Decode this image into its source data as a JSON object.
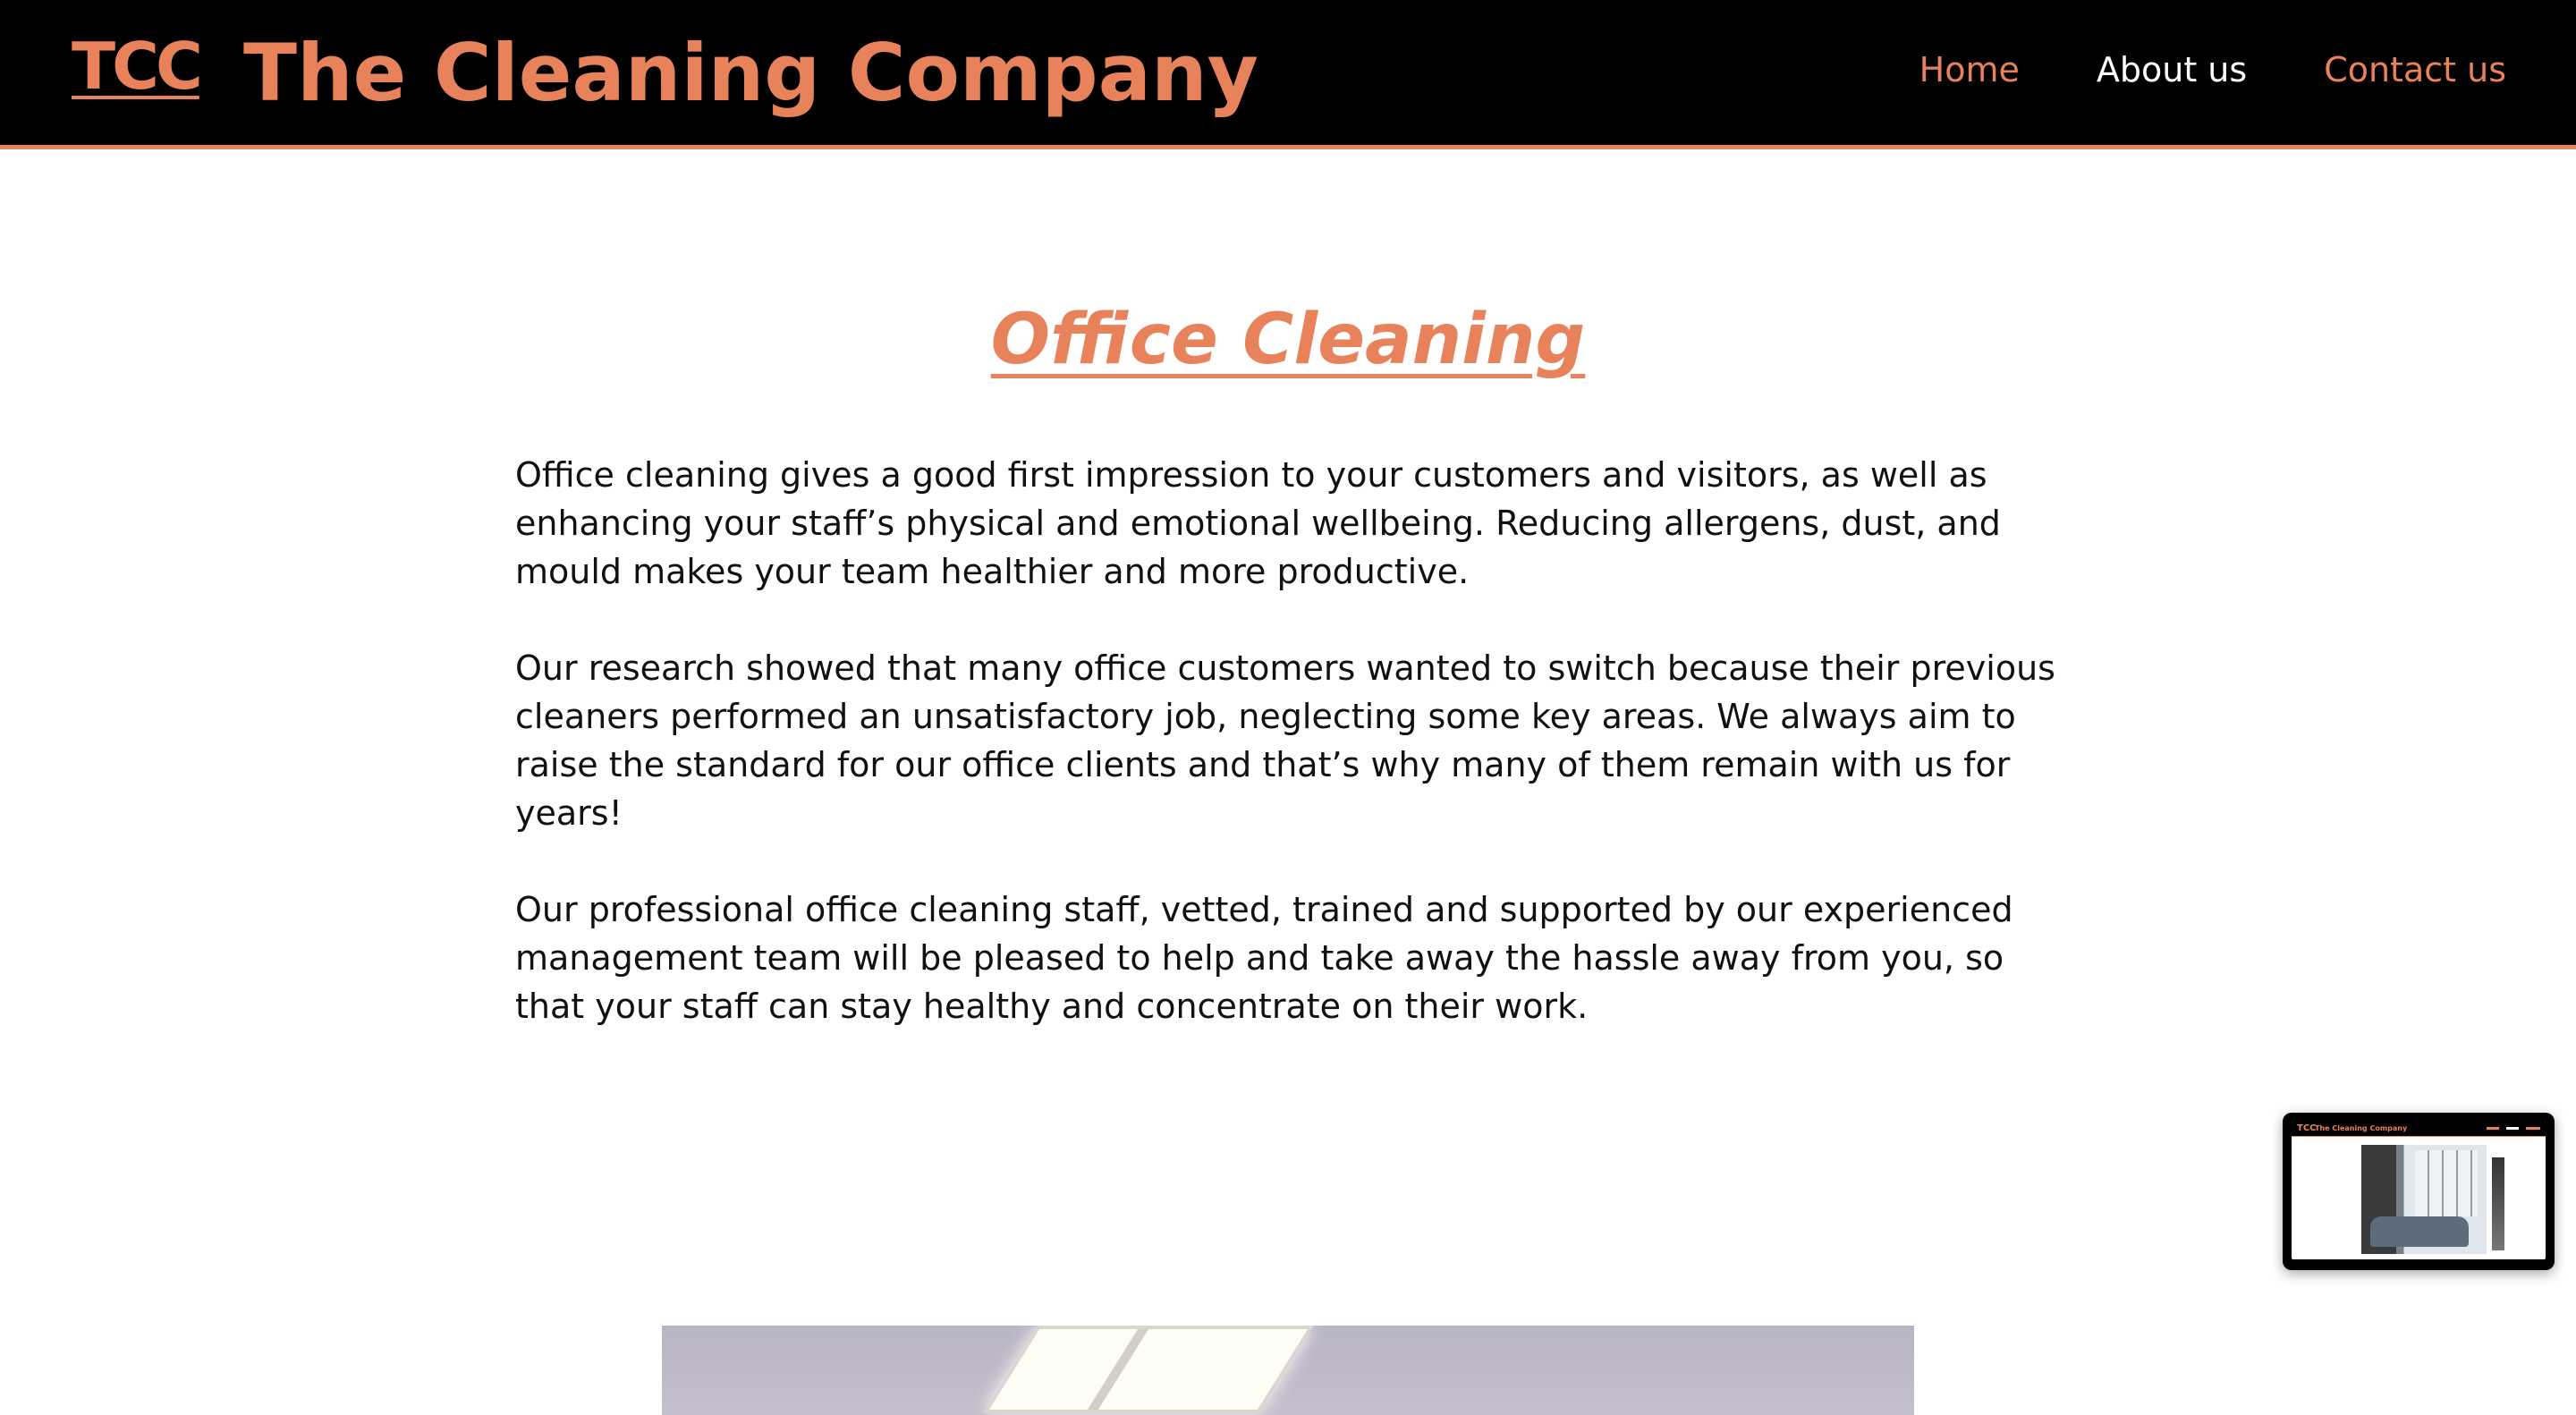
{
  "header": {
    "logo_text": "TCC",
    "site_title": "The Cleaning Company",
    "nav": [
      {
        "label": "Home",
        "active": false
      },
      {
        "label": "About us",
        "active": true
      },
      {
        "label": "Contact us",
        "active": false
      }
    ]
  },
  "main": {
    "title": "Office Cleaning",
    "paragraphs": [
      "Office cleaning gives a good first impression to your customers and visitors, as well as enhancing your staff’s physical and emotional wellbeing. Reducing allergens, dust, and mould makes your team healthier and more productive.",
      "Our research showed that many office customers wanted to switch because their previous cleaners performed an unsatisfactory job, neglecting some key areas. We always aim to raise the standard for our office clients and that’s why many of them remain with us for years!",
      "Our professional office cleaning staff, vetted, trained and supported by our experienced management team will be pleased to help and take away the hassle away from you, so that your staff can stay healthy and concentrate on their work."
    ]
  },
  "mini_preview": {
    "logo_text": "TCC",
    "site_title": "The Cleaning Company"
  },
  "colors": {
    "accent": "#e8825a",
    "header_bg": "#000000",
    "text": "#111111",
    "nav_active": "#ffffff"
  }
}
